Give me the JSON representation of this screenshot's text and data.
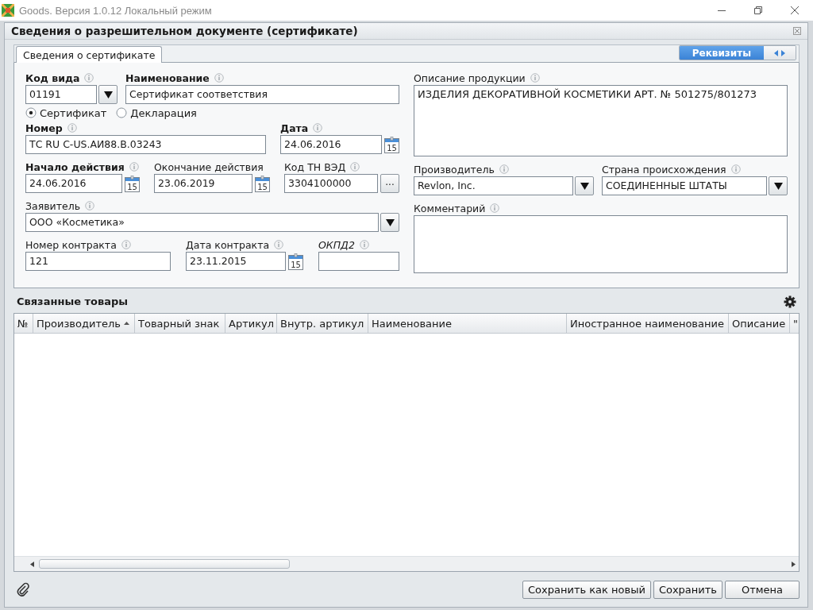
{
  "app_title": "Goods. Версия 1.0.12 Локальный режим",
  "dialog_title": "Сведения о разрешительном документе (сертификате)",
  "tabs": [
    {
      "label": "Сведения о сертификате",
      "selected": true
    }
  ],
  "view_switch": [
    {
      "kind": "label",
      "label": "Реквизиты",
      "selected": true
    },
    {
      "kind": "arrows",
      "selected": false
    }
  ],
  "form": {
    "left_rows": [
      {
        "kind": "fields",
        "fields": [
          {
            "kind": "dropdown",
            "label": "Код вида",
            "bold": true,
            "italic": false,
            "info": true,
            "value": "01191"
          },
          {
            "kind": "text",
            "label": "Наименование",
            "bold": true,
            "italic": false,
            "info": true,
            "value": "Сертификат соответствия"
          }
        ]
      },
      {
        "kind": "radios",
        "options": [
          {
            "label": "Сертификат",
            "selected": true
          },
          {
            "label": "Декларация",
            "selected": false
          }
        ]
      },
      {
        "kind": "fields",
        "fields": [
          {
            "kind": "text",
            "label": "Номер",
            "bold": true,
            "italic": false,
            "info": true,
            "value": "ТС RU С-US.АИ88.В.03243"
          },
          {
            "kind": "date",
            "label": "Дата",
            "bold": true,
            "italic": false,
            "info": true,
            "value": "24.06.2016",
            "calendar_day": "15"
          }
        ]
      },
      {
        "kind": "fields",
        "fields": [
          {
            "kind": "date",
            "label": "Начало действия",
            "bold": true,
            "italic": false,
            "info": true,
            "value": "24.06.2016",
            "calendar_day": "15"
          },
          {
            "kind": "date",
            "label": "Окончание действия",
            "bold": false,
            "italic": false,
            "info": false,
            "value": "23.06.2019",
            "calendar_day": "15"
          },
          {
            "kind": "lookup",
            "label": "Код ТН ВЭД",
            "bold": false,
            "italic": false,
            "info": true,
            "value": "3304100000",
            "button_label": "..."
          }
        ]
      },
      {
        "kind": "fields",
        "fields": [
          {
            "kind": "dropdown",
            "label": "Заявитель",
            "bold": false,
            "italic": false,
            "info": true,
            "value": "ООО «Косметика»"
          }
        ]
      },
      {
        "kind": "fields",
        "fields": [
          {
            "kind": "text",
            "label": "Номер контракта",
            "bold": false,
            "italic": false,
            "info": true,
            "value": "121"
          },
          {
            "kind": "date",
            "label": "Дата контракта",
            "bold": false,
            "italic": false,
            "info": true,
            "value": "23.11.2015",
            "calendar_day": "15"
          },
          {
            "kind": "text",
            "label": "ОКПД2",
            "bold": false,
            "italic": true,
            "info": true
          }
        ]
      }
    ],
    "right_rows": [
      {
        "kind": "fields",
        "fields": [
          {
            "kind": "textarea",
            "label": "Описание продукции",
            "bold": false,
            "italic": false,
            "info": true,
            "value": "ИЗДЕЛИЯ ДЕКОРАТИВНОЙ КОСМЕТИКИ АРТ. № 501275/801273"
          }
        ]
      },
      {
        "kind": "fields",
        "fields": [
          {
            "kind": "dropdown",
            "label": "Производитель",
            "bold": false,
            "italic": false,
            "info": true,
            "value": "Revlon, Inc."
          },
          {
            "kind": "dropdown",
            "label": "Страна происхождения",
            "bold": false,
            "italic": false,
            "info": true,
            "value": "СОЕДИНЕННЫЕ ШТАТЫ"
          }
        ]
      },
      {
        "kind": "fields",
        "fields": [
          {
            "kind": "textarea",
            "label": "Комментарий",
            "bold": false,
            "italic": false,
            "info": true
          }
        ]
      }
    ]
  },
  "related_goods": {
    "title": "Связанные товары",
    "columns": [
      {
        "label": "№",
        "sorted": false
      },
      {
        "label": "Производитель",
        "sorted": true
      },
      {
        "label": "Товарный знак",
        "sorted": false
      },
      {
        "label": "Артикул",
        "sorted": false
      },
      {
        "label": "Внутр. артикул",
        "sorted": false
      },
      {
        "label": "Наименование",
        "sorted": false
      },
      {
        "label": "Иностранное наименование",
        "sorted": false
      },
      {
        "label": "Описание",
        "sorted": false
      },
      {
        "label": "\"",
        "sorted": false
      }
    ]
  },
  "buttons": [
    "Сохранить как новый",
    "Сохранить",
    "Отмена"
  ]
}
